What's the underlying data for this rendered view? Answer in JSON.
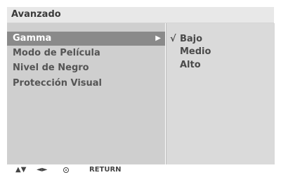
{
  "menu": {
    "title": "Avanzado",
    "items": [
      {
        "label": "Gamma",
        "selected": true,
        "has_submenu": true
      },
      {
        "label": "Modo de Película",
        "selected": false
      },
      {
        "label": "Nivel de Negro",
        "selected": false
      },
      {
        "label": "Protección Visual",
        "selected": false
      }
    ],
    "submenu_arrow_icon": "triangle-right-icon"
  },
  "submenu": {
    "options": [
      {
        "label": "Bajo",
        "checked": true,
        "check_mark": "√"
      },
      {
        "label": "Medio",
        "checked": false,
        "check_mark": ""
      },
      {
        "label": "Alto",
        "checked": false,
        "check_mark": ""
      }
    ]
  },
  "footer": {
    "up_down_icon": "▲▼",
    "left_right_icon": "◄►",
    "ok_icon": "ok-circle-icon",
    "return_label": "RETURN"
  },
  "colors": {
    "selected_bg": "#8a8a8a",
    "panel_bg": "#cfcfcf",
    "title_bg": "#e8e8e8"
  }
}
